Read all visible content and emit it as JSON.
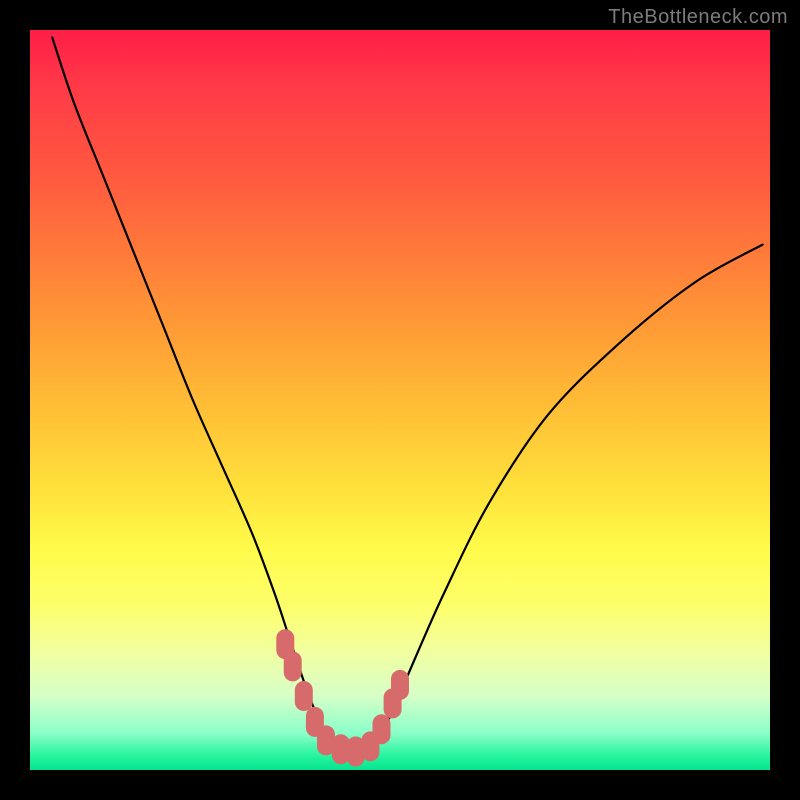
{
  "watermark": "TheBottleneck.com",
  "chart_data": {
    "type": "line",
    "title": "",
    "xlabel": "",
    "ylabel": "",
    "xlim": [
      0,
      100
    ],
    "ylim": [
      0,
      100
    ],
    "series": [
      {
        "name": "bottleneck-curve",
        "x": [
          3,
          6,
          10,
          14,
          18,
          22,
          26,
          30,
          33,
          35,
          37,
          38.5,
          40,
          42,
          44,
          46,
          47,
          49,
          52,
          56,
          62,
          70,
          80,
          90,
          99
        ],
        "values": [
          99,
          90,
          80,
          70,
          60,
          50,
          41,
          32,
          24,
          18,
          12,
          8,
          4.5,
          2.6,
          2.2,
          2.6,
          4,
          8,
          15,
          24,
          36,
          48,
          58,
          66,
          71
        ]
      }
    ],
    "highlight_points": {
      "name": "near-optimal-markers",
      "color": "#d76b6b",
      "points": [
        {
          "x": 34.5,
          "y": 17
        },
        {
          "x": 35.5,
          "y": 14
        },
        {
          "x": 37.0,
          "y": 10
        },
        {
          "x": 38.5,
          "y": 6.5
        },
        {
          "x": 40.0,
          "y": 4.0
        },
        {
          "x": 42.0,
          "y": 2.8
        },
        {
          "x": 44.0,
          "y": 2.5
        },
        {
          "x": 46.0,
          "y": 3.2
        },
        {
          "x": 47.5,
          "y": 5.5
        },
        {
          "x": 49.0,
          "y": 9.0
        },
        {
          "x": 50.0,
          "y": 11.5
        }
      ]
    }
  }
}
